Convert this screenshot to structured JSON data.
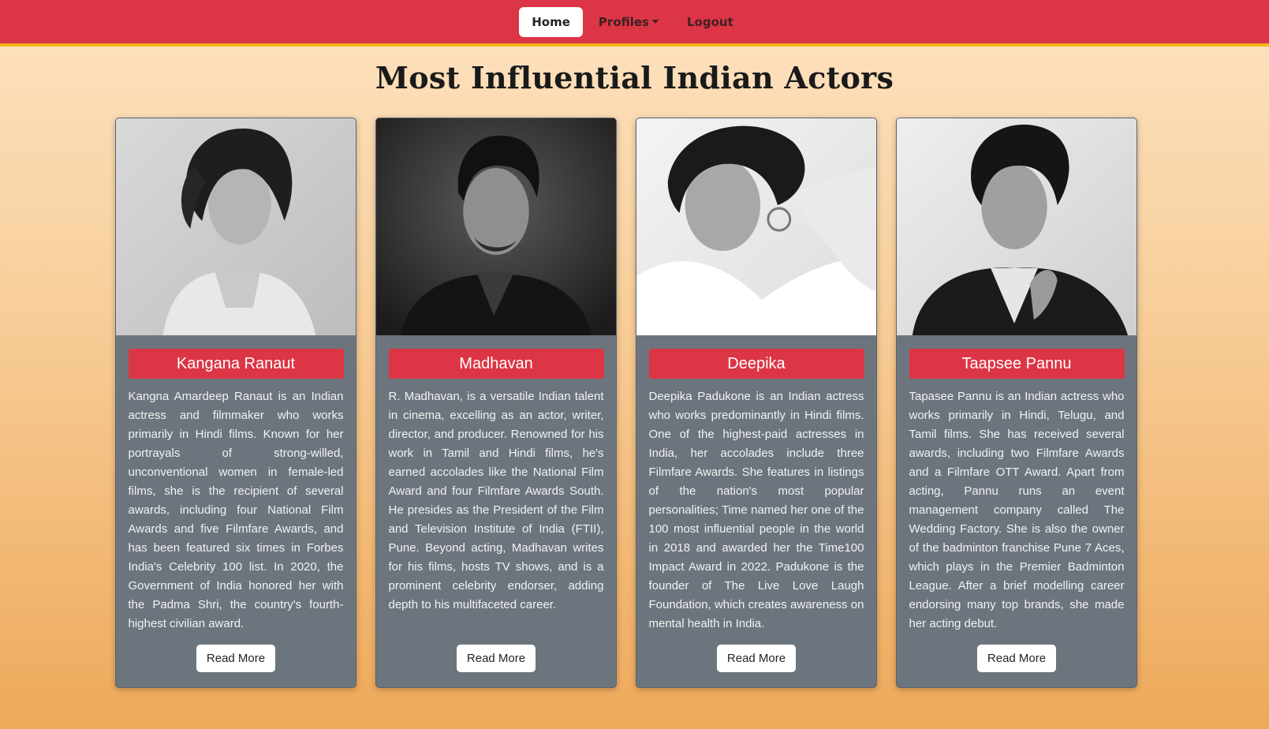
{
  "nav": {
    "home": "Home",
    "profiles": "Profiles",
    "logout": "Logout"
  },
  "page_title": "Most Influential Indian Actors",
  "cards": [
    {
      "name": "Kangana Ranaut",
      "description": "Kangna Amardeep Ranaut is an Indian actress and filmmaker who works primarily in Hindi films. Known for her portrayals of strong-willed, unconventional women in female-led films, she is the recipient of several awards, including four National Film Awards and five Filmfare Awards, and has been featured six times in Forbes India's Celebrity 100 list. In 2020, the Government of India honored her with the Padma Shri, the country's fourth-highest civilian award.",
      "button": "Read More"
    },
    {
      "name": "Madhavan",
      "description": "R. Madhavan, is a versatile Indian talent in cinema, excelling as an actor, writer, director, and producer. Renowned for his work in Tamil and Hindi films, he's earned accolades like the National Film Award and four Filmfare Awards South. He presides as the President of the Film and Television Institute of India (FTII), Pune. Beyond acting, Madhavan writes for his films, hosts TV shows, and is a prominent celebrity endorser, adding depth to his multifaceted career.",
      "button": "Read More"
    },
    {
      "name": "Deepika",
      "description": "Deepika Padukone is an Indian actress who works predominantly in Hindi films. One of the highest-paid actresses in India, her accolades include three Filmfare Awards. She features in listings of the nation's most popular personalities; Time named her one of the 100 most influential people in the world in 2018 and awarded her the Time100 Impact Award in 2022. Padukone is the founder of The Live Love Laugh Foundation, which creates awareness on mental health in India.",
      "button": "Read More"
    },
    {
      "name": "Taapsee Pannu",
      "description": "Tapasee Pannu is an Indian actress who works primarily in Hindi, Telugu, and Tamil films. She has received several awards, including two Filmfare Awards and a Filmfare OTT Award. Apart from acting, Pannu runs an event management company called The Wedding Factory. She is also the owner of the badminton franchise Pune 7 Aces, which plays in the Premier Badminton League. After a brief modelling career endorsing many top brands, she made her acting debut.",
      "button": "Read More"
    }
  ]
}
